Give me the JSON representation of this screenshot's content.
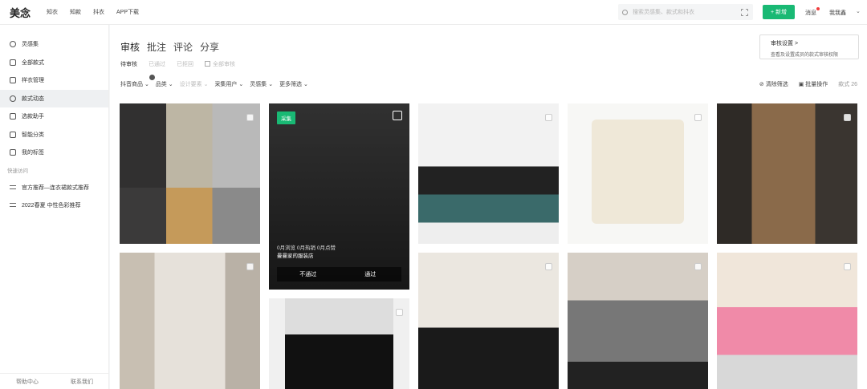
{
  "header": {
    "logo": "美念",
    "nav": [
      "知衣",
      "知款",
      "抖衣",
      "APP下载"
    ],
    "search_placeholder": "搜索灵感集、款式和抖衣",
    "new_button": "+ 新增",
    "messages": "消息",
    "user": "我我鑫"
  },
  "sidebar": {
    "items": [
      {
        "label": "灵感集",
        "icon": "lightbulb-icon"
      },
      {
        "label": "全部款式",
        "icon": "grid-icon"
      },
      {
        "label": "样衣管理",
        "icon": "clipboard-icon"
      },
      {
        "label": "款式动态",
        "icon": "trend-icon"
      },
      {
        "label": "选款助手",
        "icon": "assistant-icon"
      },
      {
        "label": "智能分类",
        "icon": "layers-icon"
      },
      {
        "label": "我的标签",
        "icon": "tag-icon"
      }
    ],
    "group_label": "快速访问",
    "quick_links": [
      "官方推荐—连衣裙款式推荐",
      "2022春夏 中性色彩推荐"
    ],
    "footer": [
      "帮助中心",
      "联系我们"
    ]
  },
  "main": {
    "tabs": [
      "审核",
      "批注",
      "评论",
      "分享"
    ],
    "subtabs": [
      "待审核",
      "已通过",
      "已拒回"
    ],
    "all_review": "全部审核",
    "review_settings_title": "审核设置  >",
    "review_settings_desc": "查看及设置成员的款式审核权限",
    "filters": [
      "抖音商品",
      "品类",
      "设计要素",
      "采集用户",
      "灵感集",
      "更多筛选"
    ],
    "tools": [
      "清除筛选",
      "批量操作"
    ],
    "count_label": "款式 26"
  },
  "cards": [
    {
      "badge": "采集",
      "stats": "0月浏览  0月热销  0月点赞",
      "shop": "曼曼家的服装店",
      "reject": "不通过",
      "approve": "通过"
    }
  ]
}
